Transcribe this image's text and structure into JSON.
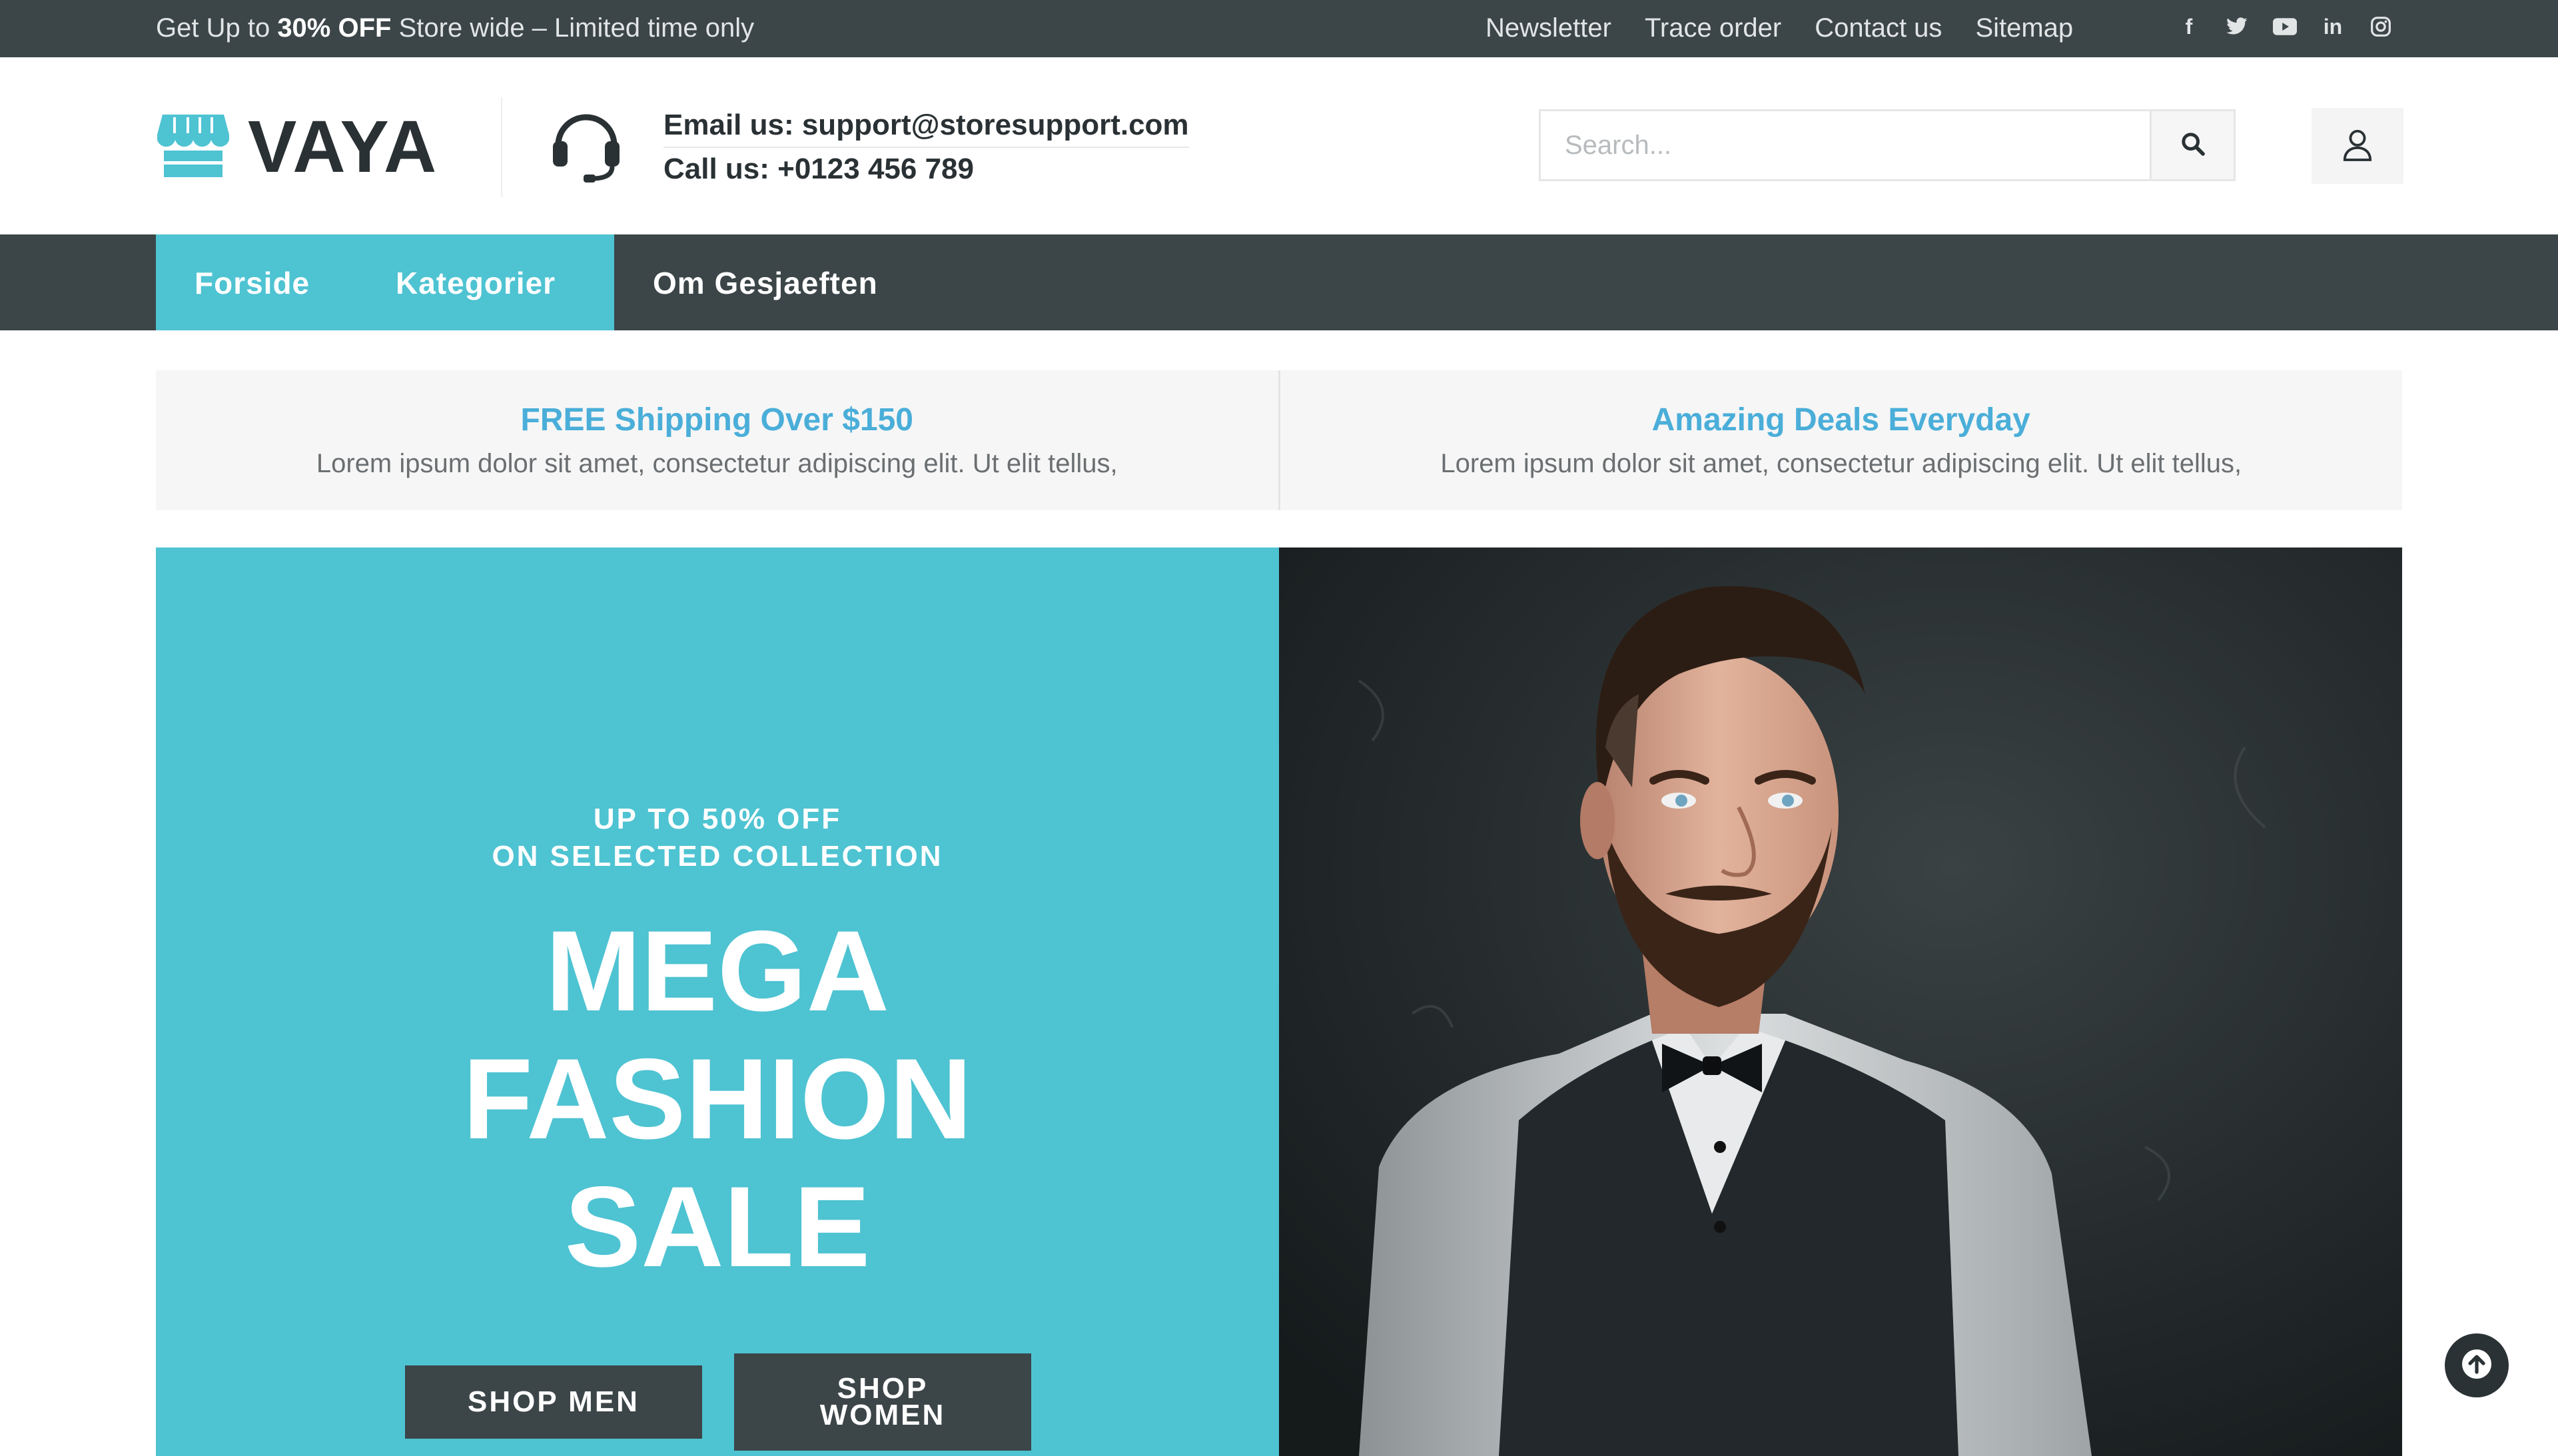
{
  "topbar": {
    "promo_prefix": "Get Up to ",
    "promo_bold": "30% OFF",
    "promo_suffix": " Store wide – Limited time only",
    "links": [
      "Newsletter",
      "Trace order",
      "Contact us",
      "Sitemap"
    ],
    "social_icons": [
      "facebook-icon",
      "twitter-icon",
      "youtube-icon",
      "linkedin-icon",
      "instagram-icon"
    ]
  },
  "header": {
    "logo_text": "VAYA",
    "email_line": "Email us: support@storesupport.com",
    "phone_line": "Call us: +0123 456 789",
    "search_placeholder": "Search..."
  },
  "nav": {
    "items": [
      "Forside",
      "Kategorier",
      "Om Gesjaeften"
    ]
  },
  "features": [
    {
      "title": "FREE Shipping Over $150",
      "text": "Lorem ipsum dolor sit amet, consectetur adipiscing elit. Ut elit tellus,"
    },
    {
      "title": "Amazing Deals Everyday",
      "text": "Lorem ipsum dolor sit amet, consectetur adipiscing elit. Ut elit tellus,"
    }
  ],
  "hero": {
    "sub_line1": "UP TO 50% OFF",
    "sub_line2": "ON SELECTED COLLECTION",
    "title_line1": "MEGA",
    "title_line2": "FASHION",
    "title_line3": "SALE",
    "btn_men": "SHOP MEN",
    "btn_women_line1": "SHOP",
    "btn_women_line2": "WOMEN"
  },
  "colors": {
    "accent": "#4ec3d2",
    "dark": "#3c4548",
    "feature_title": "#4aaed9"
  }
}
